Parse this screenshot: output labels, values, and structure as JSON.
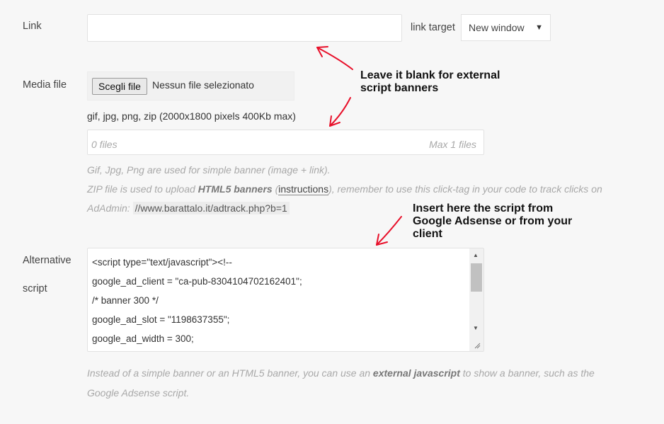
{
  "link": {
    "label": "Link",
    "value": "",
    "target_label": "link target",
    "target_value": "New window"
  },
  "media": {
    "label": "Media file",
    "button_label": "Scegli file",
    "no_file_text": "Nessun file selezionato",
    "formats": "gif, jpg, png, zip (2000x1800 pixels 400Kb max)",
    "files_count": "0 files",
    "files_max": "Max 1 files",
    "hint_line1": "Gif, Jpg, Png are used for simple banner (image + link).",
    "hint_line2_a": "ZIP file is used to upload ",
    "hint_line2_b": "HTML5 banners",
    "hint_line2_c": " (",
    "hint_line2_link": "instructions",
    "hint_line2_d": "), remember to use this click-tag in your code to track clicks on",
    "hint_line3_a": "AdAdmin: ",
    "hint_line3_url": "//www.barattalo.it/adtrack.php?b=1"
  },
  "script": {
    "label_line1": "Alternative",
    "label_line2": "script",
    "value": "<script type=\"text/javascript\"><!--\ngoogle_ad_client = \"ca-pub-8304104702162401\";\n/* banner 300 */\ngoogle_ad_slot = \"1198637355\";\ngoogle_ad_width = 300;",
    "hint_a": "Instead of a simple banner or an HTML5 banner, you can use an ",
    "hint_b": "external javascript",
    "hint_c": " to show a banner, such as the",
    "hint_line2": "Google Adsense script."
  },
  "annotations": {
    "a1_line1": "Leave it blank for external",
    "a1_line2": "script banners",
    "a2_line1": "Insert here the script from",
    "a2_line2": "Google Adsense or from your",
    "a2_line3": "client"
  },
  "colors": {
    "annotation_arrow": "#e8102a",
    "background": "#f7f7f7"
  }
}
